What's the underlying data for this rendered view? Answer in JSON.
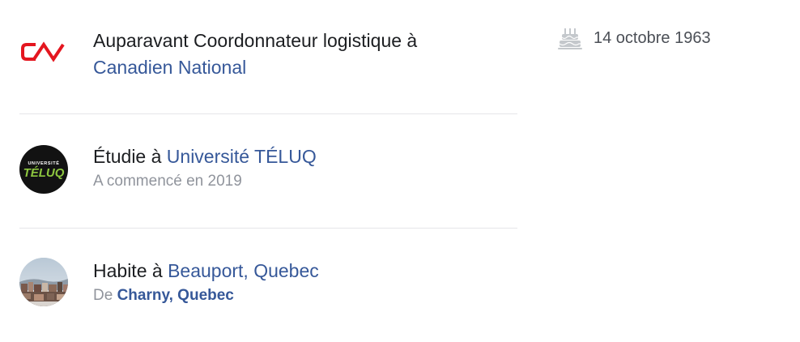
{
  "entries": [
    {
      "prefix": "Auparavant Coordonnateur logistique à",
      "link": "Canadien National",
      "icon": "cn-logo-icon"
    },
    {
      "prefix": "Étudie à",
      "link": "Université TÉLUQ",
      "sub": "A commencé en 2019",
      "icon": "teluq-logo-icon",
      "logo_text_top": "UNIVERSITÉ",
      "logo_text_main": "TÉLUQ"
    },
    {
      "prefix": "Habite à",
      "link": "Beauport, Quebec",
      "sub_prefix": "De",
      "sub_link": "Charny, Quebec",
      "icon": "city-photo-icon"
    }
  ],
  "birthday": {
    "icon": "birthday-cake-icon",
    "date": "14 octobre 1963"
  },
  "colors": {
    "link": "#365899",
    "cn_red": "#e4161f",
    "teluq_green": "#8dc63f",
    "secondary_text": "#90949c",
    "divider": "#e5e6e9"
  }
}
